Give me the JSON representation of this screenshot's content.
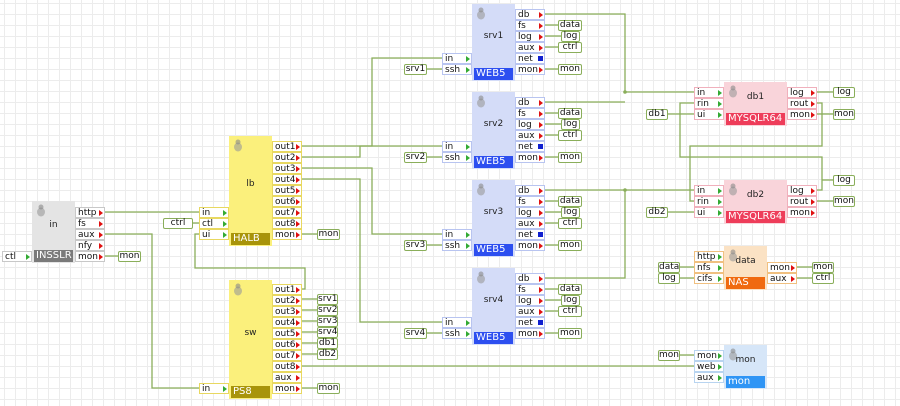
{
  "colors": {
    "wire": "#8aae5a",
    "out_marker": "#e01010",
    "in_marker": "#33aa33",
    "net_marker": "#1020d0"
  },
  "blocks": [
    {
      "name": "in",
      "type": "INSSLR",
      "theme": "gray",
      "inputs": [
        "ctl"
      ],
      "outputs": [
        "http",
        "fs",
        "aux",
        "nfy",
        "mon"
      ]
    },
    {
      "name": "lb",
      "type": "HALB",
      "theme": "yellow",
      "inputs": [
        "in",
        "ctl",
        "ui"
      ],
      "outputs": [
        "out1",
        "out2",
        "out3",
        "out4",
        "out5",
        "out6",
        "out7",
        "out8",
        "mon"
      ]
    },
    {
      "name": "sw",
      "type": "PS8",
      "theme": "yellow",
      "inputs": [
        "in"
      ],
      "outputs": [
        "out1",
        "out2",
        "out3",
        "out4",
        "out5",
        "out6",
        "out7",
        "out8",
        "aux",
        "mon"
      ]
    },
    {
      "name": "srv1",
      "type": "WEB5",
      "theme": "blue",
      "inputs": [
        "in",
        "ssh"
      ],
      "outputs": [
        "db",
        "fs",
        "log",
        "aux",
        "net",
        "mon"
      ]
    },
    {
      "name": "srv2",
      "type": "WEB5",
      "theme": "blue",
      "inputs": [
        "in",
        "ssh"
      ],
      "outputs": [
        "db",
        "fs",
        "log",
        "aux",
        "net",
        "mon"
      ]
    },
    {
      "name": "srv3",
      "type": "WEB5",
      "theme": "blue",
      "inputs": [
        "in",
        "ssh"
      ],
      "outputs": [
        "db",
        "fs",
        "log",
        "aux",
        "net",
        "mon"
      ]
    },
    {
      "name": "srv4",
      "type": "WEB5",
      "theme": "blue",
      "inputs": [
        "in",
        "ssh"
      ],
      "outputs": [
        "db",
        "fs",
        "log",
        "aux",
        "net",
        "mon"
      ]
    },
    {
      "name": "db1",
      "type": "MYSQLR64",
      "theme": "pink",
      "inputs": [
        "in",
        "rin",
        "ui"
      ],
      "outputs": [
        "log",
        "rout",
        "mon"
      ]
    },
    {
      "name": "db2",
      "type": "MYSQLR64",
      "theme": "pink",
      "inputs": [
        "in",
        "rin",
        "ui"
      ],
      "outputs": [
        "log",
        "rout",
        "mon"
      ]
    },
    {
      "name": "data",
      "type": "NAS",
      "theme": "orange",
      "inputs": [
        "http",
        "nfs",
        "cifs"
      ],
      "outputs": [
        "mon",
        "aux"
      ]
    },
    {
      "name": "mon",
      "type": "mon",
      "theme": "skyblue",
      "inputs": [
        "mon",
        "web",
        "aux"
      ],
      "outputs": []
    }
  ],
  "tags": [
    "mon",
    "ctrl",
    "mon",
    "srv1",
    "srv2",
    "srv3",
    "srv4",
    "db1",
    "db2",
    "mon",
    "srv1",
    "data",
    "log",
    "ctrl",
    "mon",
    "srv2",
    "data",
    "log",
    "ctrl",
    "mon",
    "srv3",
    "data",
    "log",
    "ctrl",
    "mon",
    "srv4",
    "data",
    "log",
    "ctrl",
    "mon",
    "db1",
    "log",
    "mon",
    "db2",
    "log",
    "mon",
    "data",
    "log",
    "mon",
    "ctrl",
    "mon"
  ]
}
